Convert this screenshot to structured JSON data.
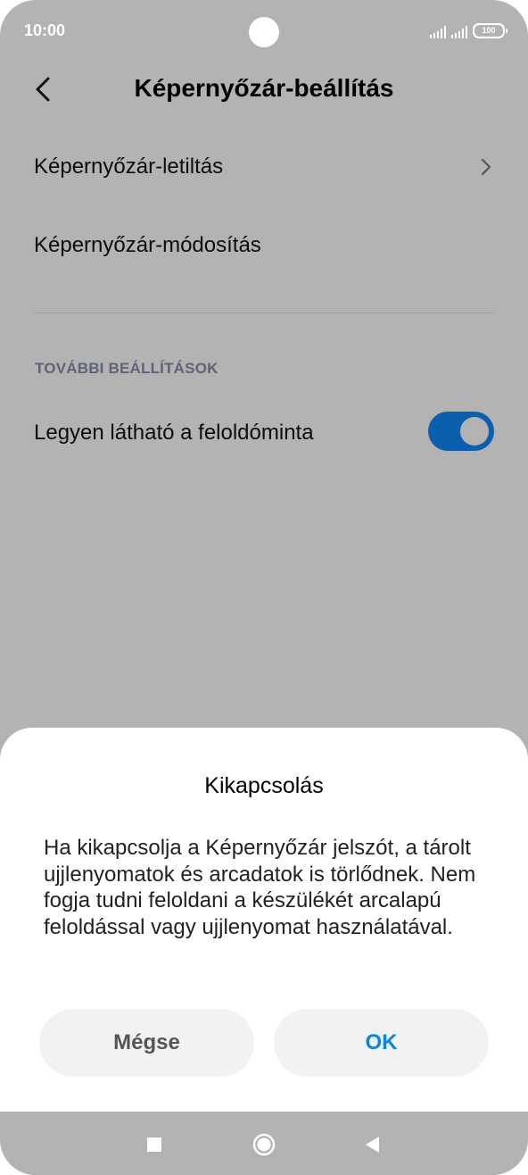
{
  "status_bar": {
    "time": "10:00",
    "battery": "100"
  },
  "header": {
    "title": "Képernyőzár-beállítás",
    "back_icon": "chevron-left-icon"
  },
  "settings": {
    "items": [
      {
        "label": "Képernyőzár-letiltás",
        "has_chevron": true
      },
      {
        "label": "Képernyőzár-módosítás",
        "has_chevron": false
      }
    ],
    "section_header": "TOVÁBBI BEÁLLÍTÁSOK",
    "toggle_item": {
      "label": "Legyen látható a feloldóminta",
      "enabled": true
    }
  },
  "dialog": {
    "title": "Kikapcsolás",
    "message": "Ha kikapcsolja a Képernyőzár jelszót, a tárolt ujjlenyomatok és arcadatok is törlődnek. Nem fogja tudni feloldani a készülékét arcalapú feloldással vagy ujjlenyomat használatával.",
    "cancel_label": "Mégse",
    "ok_label": "OK"
  },
  "colors": {
    "dim_background": "#b3b3b3",
    "toggle_on": "#0b5fad",
    "ok_text": "#0a84e0"
  },
  "nav_bar": {
    "icons": [
      "recents-square-icon",
      "home-circle-icon",
      "back-triangle-icon"
    ]
  }
}
